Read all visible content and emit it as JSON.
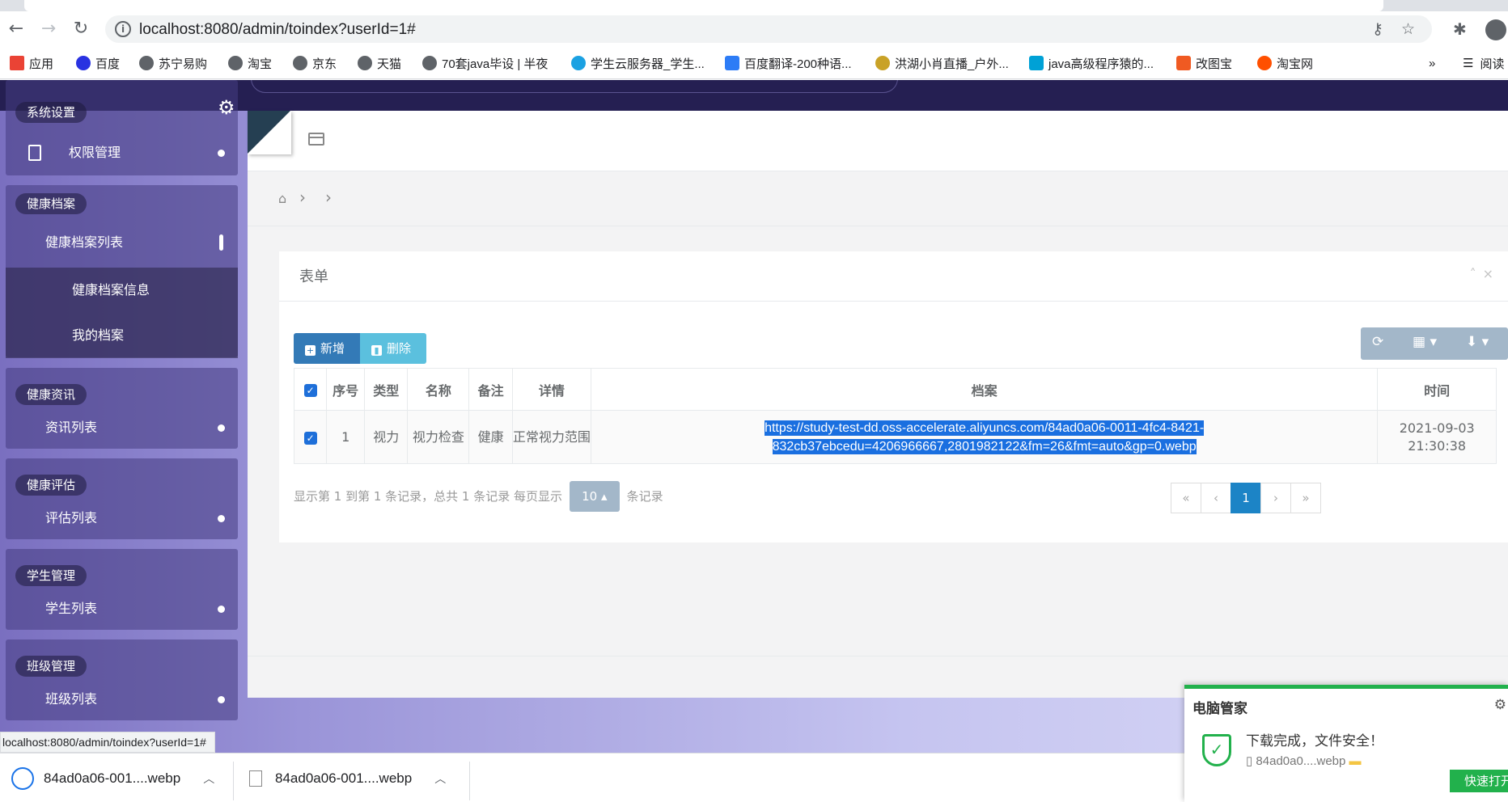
{
  "browser": {
    "url": "localhost:8080/admin/toindex?userId=1#",
    "status_url": "localhost:8080/admin/toindex?userId=1#",
    "bookmarks": [
      "应用",
      "百度",
      "苏宁易购",
      "淘宝",
      "京东",
      "天猫",
      "70套java毕设 | 半夜",
      "学生云服务器_学生...",
      "百度翻译-200种语...",
      "洪湖小肖直播_户外...",
      "java高级程序猿的...",
      "改图宝",
      "淘宝网"
    ],
    "bookmarks_more": "»",
    "reader": "阅读"
  },
  "sidebar": {
    "groups": [
      {
        "title": "系统设置",
        "items": [
          {
            "label": "权限管理"
          }
        ]
      },
      {
        "title": "健康档案",
        "items": [
          {
            "label": "健康档案列表"
          }
        ],
        "subitems": [
          "健康档案信息",
          "我的档案"
        ]
      },
      {
        "title": "健康资讯",
        "items": [
          {
            "label": "资讯列表"
          }
        ]
      },
      {
        "title": "健康评估",
        "items": [
          {
            "label": "评估列表"
          }
        ]
      },
      {
        "title": "学生管理",
        "items": [
          {
            "label": "学生列表"
          }
        ]
      },
      {
        "title": "班级管理",
        "items": [
          {
            "label": "班级列表"
          }
        ]
      }
    ]
  },
  "panel": {
    "title": "表单",
    "add_label": "新增",
    "delete_label": "删除"
  },
  "table": {
    "columns": [
      "序号",
      "类型",
      "名称",
      "备注",
      "详情",
      "档案",
      "时间"
    ],
    "rows": [
      {
        "no": "1",
        "type": "视力",
        "name": "视力检查",
        "remark": "健康",
        "detail": "正常视力范围",
        "file_line1": "https://study-test-dd.oss-accelerate.aliyuncs.com/84ad0a06-0011-4fc4-8421-",
        "file_line2": "832cb37ebcedu=4206966667,2801982122&fm=26&fmt=auto&gp=0.webp",
        "time_line1": "2021-09-03",
        "time_line2": "21:30:38"
      }
    ]
  },
  "pager": {
    "info_prefix": "显示第 1 到第 1 条记录，总共 1 条记录 每页显示",
    "page_size": "10",
    "info_suffix": "条记录",
    "pages": [
      "«",
      "‹",
      "1",
      "›",
      "»"
    ]
  },
  "downloads": [
    {
      "name": "84ad0a06-001....webp"
    },
    {
      "name": "84ad0a06-001....webp"
    }
  ],
  "toast": {
    "title": "电脑管家",
    "message": "下载完成，文件安全！",
    "file": "84ad0a0....webp",
    "open_label": "快速打开"
  }
}
